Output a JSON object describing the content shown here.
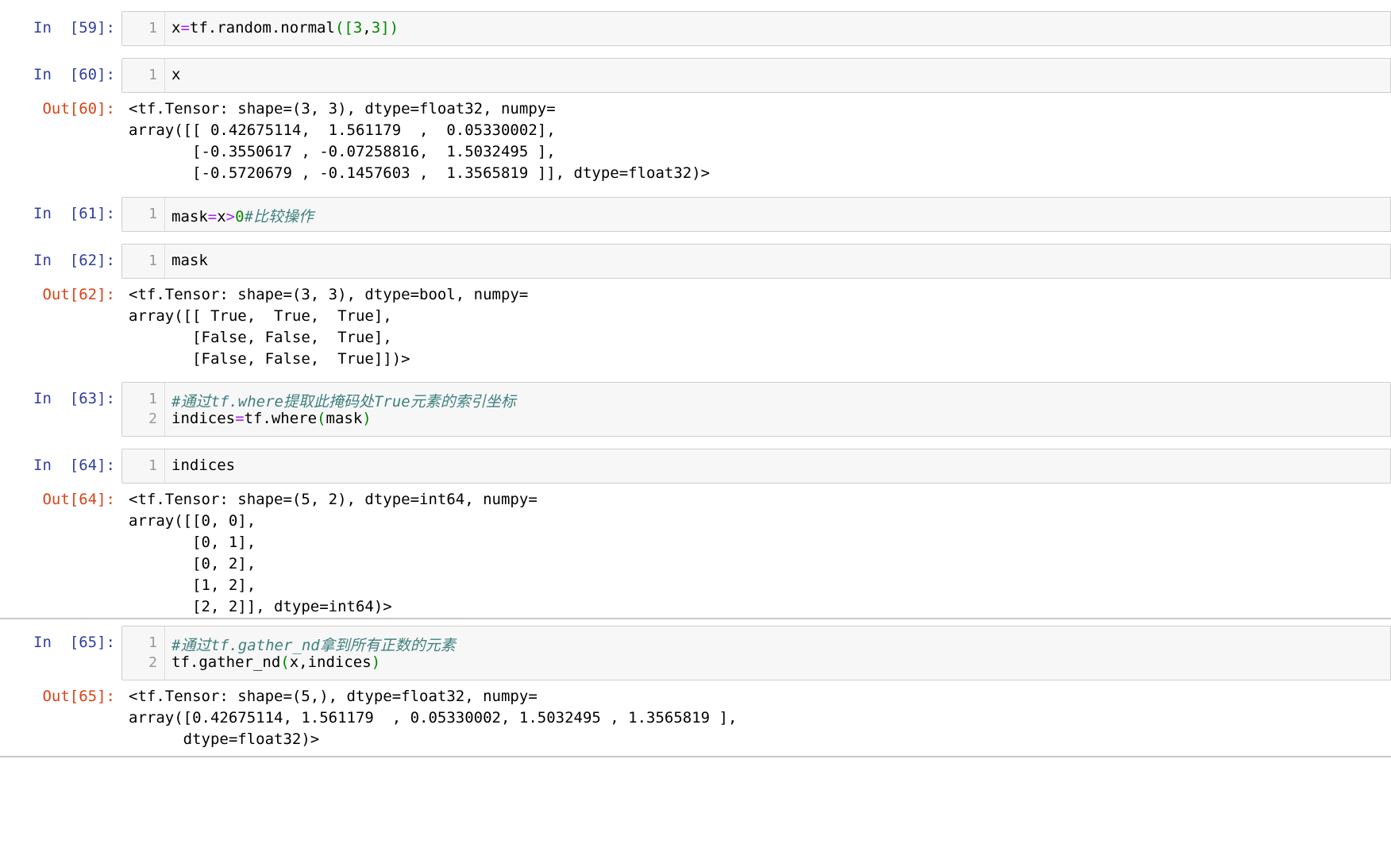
{
  "cells": [
    {
      "in_prompt": "In  [59]:",
      "lines": [
        {
          "no": "1",
          "parts": [
            {
              "t": "x",
              "c": ""
            },
            {
              "t": "=",
              "c": "op"
            },
            {
              "t": "tf.random.normal",
              "c": ""
            },
            {
              "t": "([",
              "c": "br"
            },
            {
              "t": "3",
              "c": "num"
            },
            {
              "t": ",",
              "c": ""
            },
            {
              "t": "3",
              "c": "num"
            },
            {
              "t": "])",
              "c": "br"
            }
          ]
        }
      ],
      "output": null
    },
    {
      "in_prompt": "In  [60]:",
      "lines": [
        {
          "no": "1",
          "parts": [
            {
              "t": "x",
              "c": ""
            }
          ]
        }
      ],
      "out_prompt": "Out[60]:",
      "output": "<tf.Tensor: shape=(3, 3), dtype=float32, numpy=\narray([[ 0.42675114,  1.561179  ,  0.05330002],\n       [-0.3550617 , -0.07258816,  1.5032495 ],\n       [-0.5720679 , -0.1457603 ,  1.3565819 ]], dtype=float32)>"
    },
    {
      "in_prompt": "In  [61]:",
      "lines": [
        {
          "no": "1",
          "parts": [
            {
              "t": "mask",
              "c": ""
            },
            {
              "t": "=",
              "c": "op"
            },
            {
              "t": "x",
              "c": ""
            },
            {
              "t": ">",
              "c": "op"
            },
            {
              "t": "0",
              "c": "num"
            },
            {
              "t": "#比较操作",
              "c": "cm"
            }
          ]
        }
      ],
      "output": null
    },
    {
      "in_prompt": "In  [62]:",
      "lines": [
        {
          "no": "1",
          "parts": [
            {
              "t": "mask",
              "c": ""
            }
          ]
        }
      ],
      "out_prompt": "Out[62]:",
      "output": "<tf.Tensor: shape=(3, 3), dtype=bool, numpy=\narray([[ True,  True,  True],\n       [False, False,  True],\n       [False, False,  True]])>"
    },
    {
      "in_prompt": "In  [63]:",
      "lines": [
        {
          "no": "1",
          "parts": [
            {
              "t": "#通过tf.where提取此掩码处True元素的索引坐标",
              "c": "cm"
            }
          ]
        },
        {
          "no": "2",
          "parts": [
            {
              "t": "indices",
              "c": ""
            },
            {
              "t": "=",
              "c": "op"
            },
            {
              "t": "tf.where",
              "c": ""
            },
            {
              "t": "(",
              "c": "br"
            },
            {
              "t": "mask",
              "c": ""
            },
            {
              "t": ")",
              "c": "br"
            }
          ]
        }
      ],
      "output": null
    },
    {
      "in_prompt": "In  [64]:",
      "lines": [
        {
          "no": "1",
          "parts": [
            {
              "t": "indices",
              "c": ""
            }
          ]
        }
      ],
      "out_prompt": "Out[64]:",
      "output": "<tf.Tensor: shape=(5, 2), dtype=int64, numpy=\narray([[0, 0],\n       [0, 1],\n       [0, 2],\n       [1, 2],\n       [2, 2]], dtype=int64)>"
    },
    {
      "in_prompt": "In  [65]:",
      "lines": [
        {
          "no": "1",
          "parts": [
            {
              "t": "#通过tf.gather_nd拿到所有正数的元素",
              "c": "cm"
            }
          ]
        },
        {
          "no": "2",
          "parts": [
            {
              "t": "tf.gather_nd",
              "c": ""
            },
            {
              "t": "(",
              "c": "br"
            },
            {
              "t": "x,indices",
              "c": ""
            },
            {
              "t": ")",
              "c": "br"
            }
          ]
        }
      ],
      "out_prompt": "Out[65]:",
      "output": "<tf.Tensor: shape=(5,), dtype=float32, numpy=\narray([0.42675114, 1.561179  , 0.05330002, 1.5032495 , 1.3565819 ],\n      dtype=float32)>"
    }
  ]
}
